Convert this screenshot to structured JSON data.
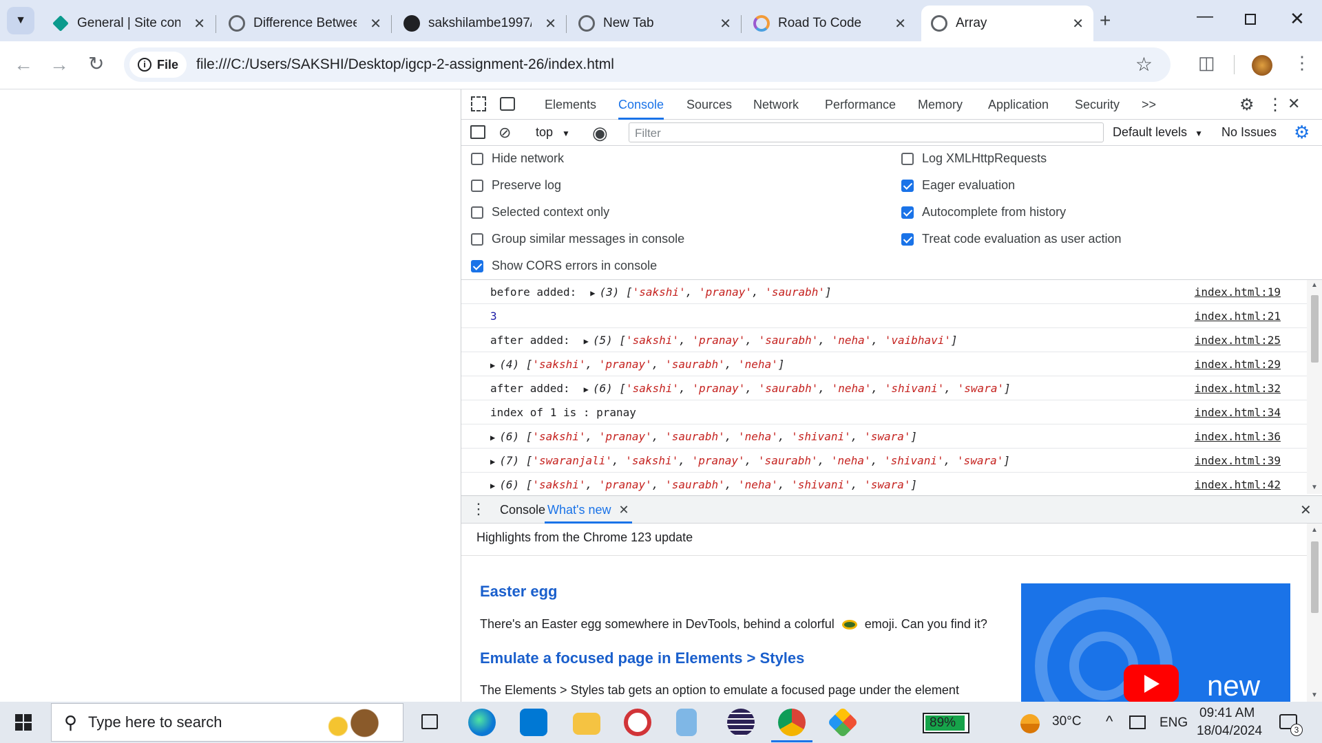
{
  "browser": {
    "tabs": [
      {
        "title": "General | Site conf",
        "icon": "diamond-icon",
        "active": false
      },
      {
        "title": "Difference Betwee",
        "icon": "globe-icon",
        "active": false
      },
      {
        "title": "sakshilambe1997/i",
        "icon": "github-icon",
        "active": false
      },
      {
        "title": "New Tab",
        "icon": "globe-icon",
        "active": false
      },
      {
        "title": "Road To Code",
        "icon": "ring-icon",
        "active": false
      },
      {
        "title": "Array",
        "icon": "globe-icon",
        "active": true
      }
    ],
    "site_chip": "File",
    "url": "file:///C:/Users/SAKSHI/Desktop/igcp-2-assignment-26/index.html"
  },
  "devtools": {
    "tabs": [
      "Elements",
      "Console",
      "Sources",
      "Network",
      "Performance",
      "Memory",
      "Application",
      "Security"
    ],
    "more": ">>",
    "context": "top",
    "filter_placeholder": "Filter",
    "levels": "Default levels",
    "issues": "No Issues",
    "settings_left": [
      {
        "label": "Hide network",
        "checked": false
      },
      {
        "label": "Preserve log",
        "checked": false
      },
      {
        "label": "Selected context only",
        "checked": false
      },
      {
        "label": "Group similar messages in console",
        "checked": false
      },
      {
        "label": "Show CORS errors in console",
        "checked": true
      }
    ],
    "settings_right": [
      {
        "label": "Log XMLHttpRequests",
        "checked": false
      },
      {
        "label": "Eager evaluation",
        "checked": true
      },
      {
        "label": "Autocomplete from history",
        "checked": true
      },
      {
        "label": "Treat code evaluation as user action",
        "checked": true
      }
    ],
    "logs": [
      {
        "prefix": "before added:",
        "count": "(3)",
        "items": [
          "'sakshi'",
          "'pranay'",
          "'saurabh'"
        ],
        "src": "index.html:19"
      },
      {
        "number": "3",
        "src": "index.html:21"
      },
      {
        "prefix": "after added:",
        "count": "(5)",
        "items": [
          "'sakshi'",
          "'pranay'",
          "'saurabh'",
          "'neha'",
          "'vaibhavi'"
        ],
        "src": "index.html:25"
      },
      {
        "prefix": "",
        "count": "(4)",
        "items": [
          "'sakshi'",
          "'pranay'",
          "'saurabh'",
          "'neha'"
        ],
        "src": "index.html:29"
      },
      {
        "prefix": "after added:",
        "count": "(6)",
        "items": [
          "'sakshi'",
          "'pranay'",
          "'saurabh'",
          "'neha'",
          "'shivani'",
          "'swara'"
        ],
        "src": "index.html:32"
      },
      {
        "text": "index of 1 is :  pranay",
        "src": "index.html:34"
      },
      {
        "prefix": "",
        "count": "(6)",
        "items": [
          "'sakshi'",
          "'pranay'",
          "'saurabh'",
          "'neha'",
          "'shivani'",
          "'swara'"
        ],
        "src": "index.html:36"
      },
      {
        "prefix": "",
        "count": "(7)",
        "items": [
          "'swaranjali'",
          "'sakshi'",
          "'pranay'",
          "'saurabh'",
          "'neha'",
          "'shivani'",
          "'swara'"
        ],
        "src": "index.html:39"
      },
      {
        "prefix": "",
        "count": "(6)",
        "items": [
          "'sakshi'",
          "'pranay'",
          "'saurabh'",
          "'neha'",
          "'shivani'",
          "'swara'"
        ],
        "src": "index.html:42"
      }
    ],
    "drawer": {
      "tabs": [
        "Console",
        "What's new"
      ],
      "header": "Highlights from the Chrome 123 update",
      "h1": "Easter egg",
      "p1a": "There's an Easter egg somewhere in DevTools, behind a colorful",
      "p1b": "emoji. Can you find it?",
      "h2": "Emulate a focused page in Elements > Styles",
      "p2": "The Elements > Styles tab gets an option to emulate a focused page under the element",
      "image_word": "new"
    }
  },
  "taskbar": {
    "search_placeholder": "Type here to search",
    "battery": "89%",
    "temperature": "30°C",
    "language": "ENG",
    "time": "09:41 AM",
    "date": "18/04/2024",
    "notifications": "3"
  },
  "colors": {
    "accent": "#1a73e8",
    "tabstrip": "#dfe7f5",
    "string": "#c5221f",
    "number": "#1a1aa6"
  }
}
